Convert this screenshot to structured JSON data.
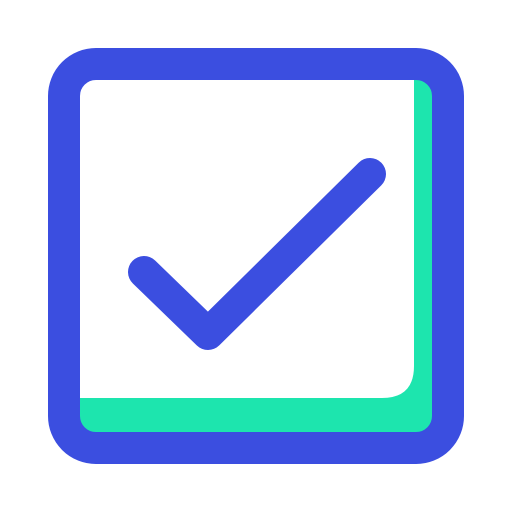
{
  "icon": {
    "name": "checkbox-checked-icon",
    "state": "checked",
    "colors": {
      "outline": "#3B4EE0",
      "shadow_accent": "#1DE5AE",
      "fill": "#FFFFFF"
    }
  }
}
